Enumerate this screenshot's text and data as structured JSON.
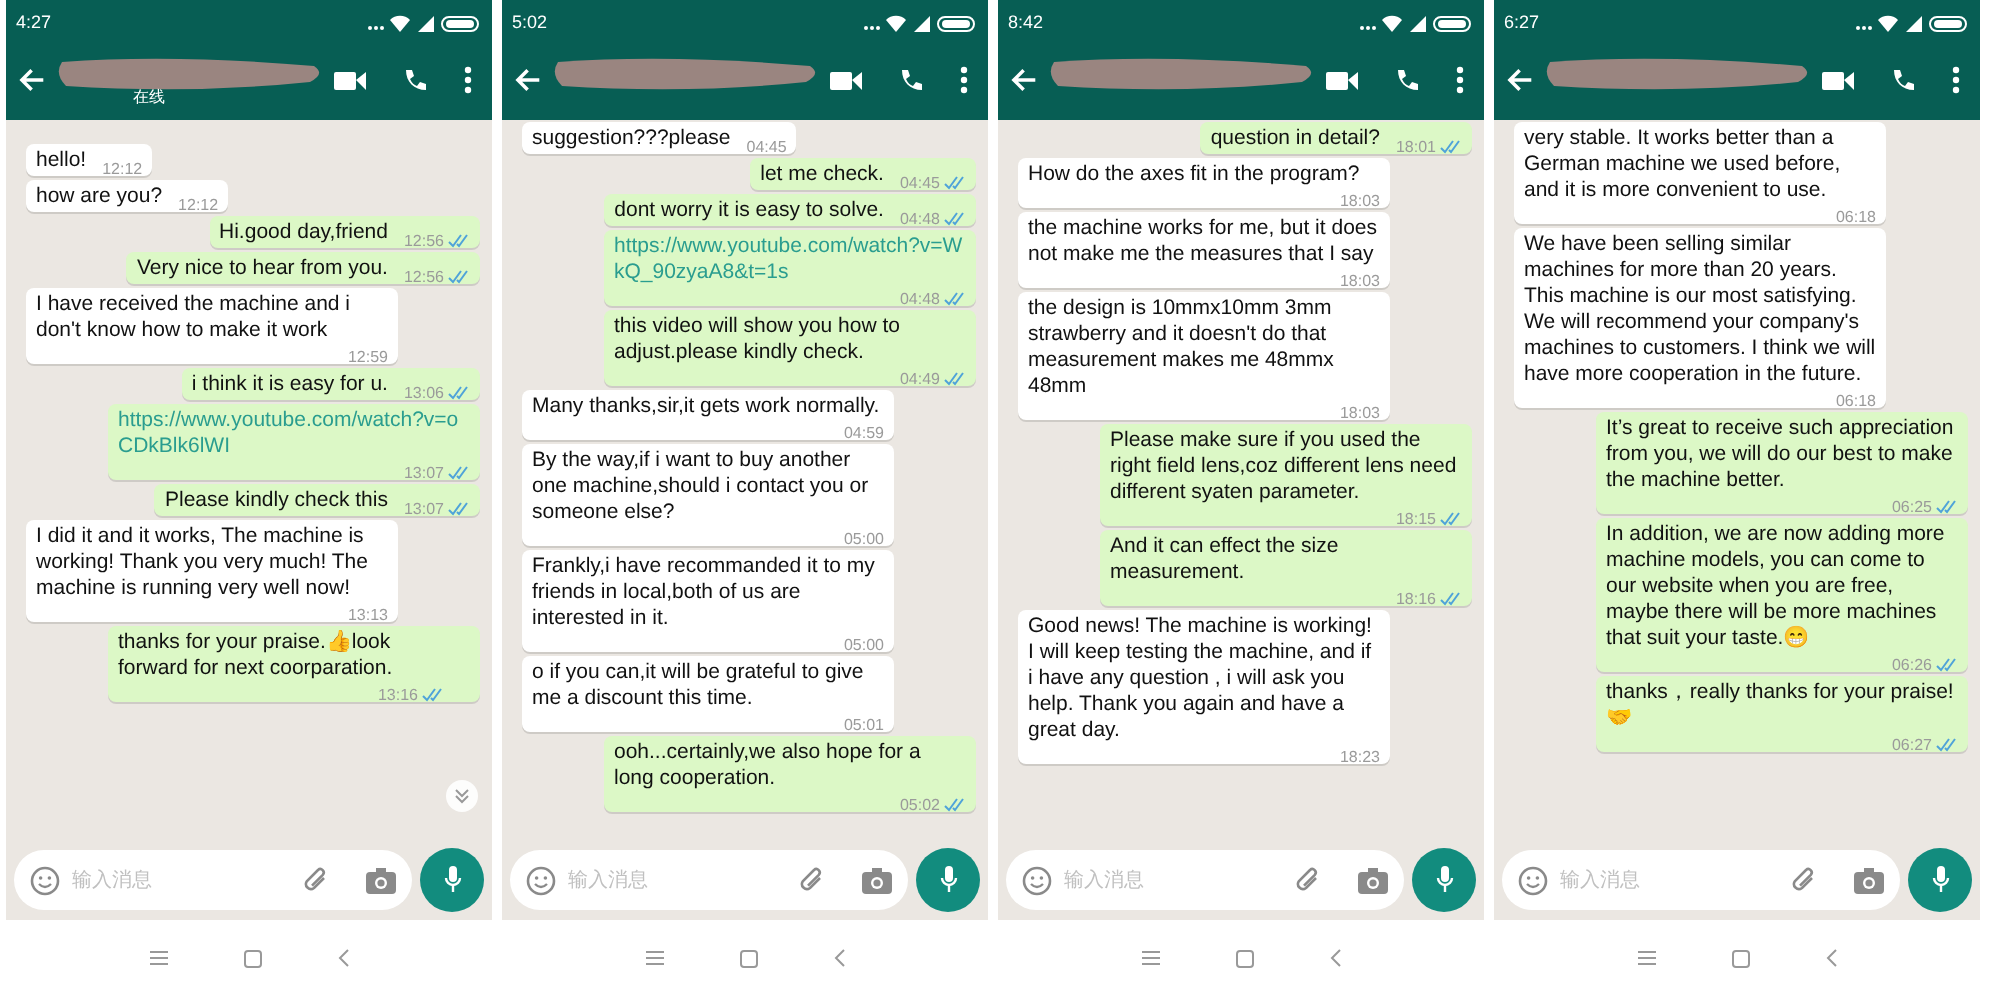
{
  "panels": [
    {
      "status_time": "4:27",
      "subtitle": "在线",
      "placeholder": "输入消息",
      "scroll_button": true,
      "messages": [
        {
          "outgoing": false,
          "kind": "text",
          "text": "hello!",
          "time": "12:12"
        },
        {
          "outgoing": false,
          "kind": "text",
          "text": "how are you?",
          "time": "12:12"
        },
        {
          "outgoing": true,
          "kind": "text",
          "text": "Hi.good day,friend",
          "time": "12:56"
        },
        {
          "outgoing": true,
          "kind": "text",
          "text": "Very nice to hear from you.",
          "time": "12:56"
        },
        {
          "outgoing": false,
          "kind": "text",
          "text": "I have received the machine and i don't know how to make it work",
          "time": "12:59"
        },
        {
          "outgoing": true,
          "kind": "text",
          "text": "i think it is easy for u.",
          "time": "13:06"
        },
        {
          "outgoing": true,
          "kind": "link",
          "text": "https://www.youtube.com/watch?v=oCDkBlk6lWI",
          "time": "13:07"
        },
        {
          "outgoing": true,
          "kind": "text",
          "text": "Please kindly check this",
          "time": "13:07"
        },
        {
          "outgoing": false,
          "kind": "text",
          "text": "I did it and it works, The machine is working! Thank you very much! The machine is running very well now!",
          "time": "13:13"
        },
        {
          "outgoing": true,
          "kind": "text",
          "text": "thanks for your praise.👍look forward for next coorparation.",
          "time": "13:16"
        }
      ]
    },
    {
      "status_time": "5:02",
      "placeholder": "输入消息",
      "scroll_button": false,
      "messages": [
        {
          "outgoing": false,
          "kind": "text",
          "text": "suggestion???please",
          "time": "04:45"
        },
        {
          "outgoing": true,
          "kind": "text",
          "text": "let me check.",
          "time": "04:45"
        },
        {
          "outgoing": true,
          "kind": "text",
          "text": "dont worry it is easy to solve.",
          "time": "04:48"
        },
        {
          "outgoing": true,
          "kind": "link",
          "text": "https://www.youtube.com/watch?v=WkQ_90zyaA8&t=1s",
          "time": "04:48"
        },
        {
          "outgoing": true,
          "kind": "text",
          "text": "this video will show you how to adjust.please kindly check.",
          "time": "04:49"
        },
        {
          "outgoing": false,
          "kind": "text",
          "text": "Many thanks,sir,it gets work normally.",
          "time": "04:59"
        },
        {
          "outgoing": false,
          "kind": "text",
          "text": "By the way,if i want to buy another one machine,should i contact you or someone else?",
          "time": "05:00"
        },
        {
          "outgoing": false,
          "kind": "text",
          "text": "Frankly,i have recommanded it to my friends in local,both of us are interested in it.",
          "time": "05:00"
        },
        {
          "outgoing": false,
          "kind": "text",
          "text": "o if you can,it will be grateful to give me a discount this time.",
          "time": "05:01"
        },
        {
          "outgoing": true,
          "kind": "text",
          "text": "ooh...certainly,we also hope for a long cooperation.",
          "time": "05:02"
        }
      ]
    },
    {
      "status_time": "8:42",
      "placeholder": "输入消息",
      "scroll_button": false,
      "messages": [
        {
          "outgoing": true,
          "kind": "text",
          "text": "question in detail?",
          "time": "18:01"
        },
        {
          "outgoing": false,
          "kind": "text",
          "text": "How do the axes fit in the program?",
          "time": "18:03"
        },
        {
          "outgoing": false,
          "kind": "text",
          "text": "the machine works for me, but it does not make me the measures that I say",
          "time": "18:03"
        },
        {
          "outgoing": false,
          "kind": "text",
          "text": "the design is 10mmx10mm 3mm strawberry and it doesn't do that measurement makes me 48mmx 48mm",
          "time": "18:03"
        },
        {
          "outgoing": true,
          "kind": "text",
          "text": "Please make sure if you used the right field lens,coz different lens need different syaten parameter.",
          "time": "18:15"
        },
        {
          "outgoing": true,
          "kind": "text",
          "text": "And it can effect the size measurement.",
          "time": "18:16"
        },
        {
          "outgoing": false,
          "kind": "text",
          "text": "Good news! The machine  is working! I will keep testing the machine, and if i have any question , i will ask you help. Thank you again and have a great day.",
          "time": "18:23"
        }
      ]
    },
    {
      "status_time": "6:27",
      "placeholder": "输入消息",
      "scroll_button": false,
      "messages": [
        {
          "outgoing": false,
          "kind": "text",
          "text": "very stable. It works better than a German machine we used before, and it is more convenient to use.",
          "time": "06:18"
        },
        {
          "outgoing": false,
          "kind": "text",
          "text": "We have been selling similar machines for more than 20 years. This machine is our most satisfying. We will recommend your company's machines to customers. I think we will have more cooperation in the future.",
          "time": "06:18"
        },
        {
          "outgoing": true,
          "kind": "text",
          "text": "It’s great to receive such appreciation from you, we will do our best to make the machine better.",
          "time": "06:25"
        },
        {
          "outgoing": true,
          "kind": "text",
          "text": "In addition, we are now adding more machine models, you can come to our website when you are free, maybe there will be more machines that suit your taste.😁",
          "time": "06:26"
        },
        {
          "outgoing": true,
          "kind": "text",
          "text": "thanks，really thanks for your praise!🤝",
          "time": "06:27"
        }
      ]
    }
  ]
}
